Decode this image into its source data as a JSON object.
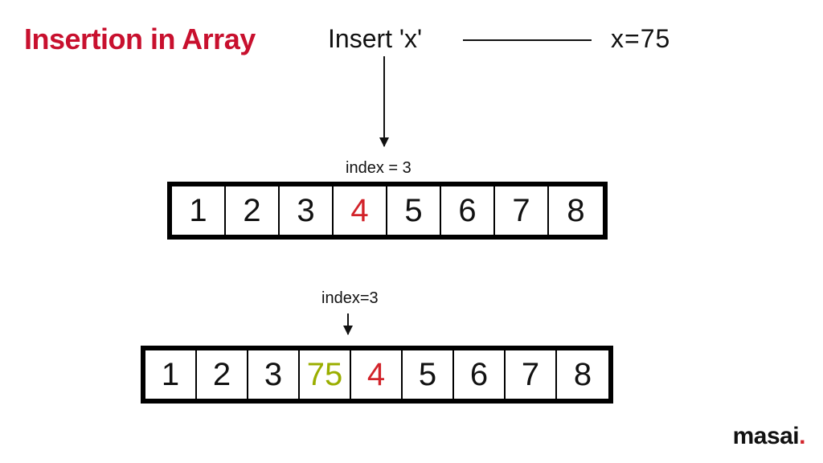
{
  "title": "Insertion in Array",
  "insert_label": "Insert 'x'",
  "x_equals": "x=75",
  "index_label_1": "index = 3",
  "index_label_2": "index=3",
  "array_before": {
    "cells": [
      "1",
      "2",
      "3",
      "4",
      "5",
      "6",
      "7",
      "8"
    ],
    "highlight_index": 3,
    "highlight_color": "red"
  },
  "array_after": {
    "cells": [
      "1",
      "2",
      "3",
      "75",
      "4",
      "5",
      "6",
      "7",
      "8"
    ],
    "inserted_index": 3,
    "inserted_color": "green",
    "shifted_highlight_index": 4,
    "shifted_highlight_color": "red"
  },
  "logo_text": "masai",
  "logo_dot": ".",
  "colors": {
    "title_red": "#c8102e",
    "highlight_red": "#d2232a",
    "highlight_green": "#9aae00",
    "border": "#000000"
  }
}
